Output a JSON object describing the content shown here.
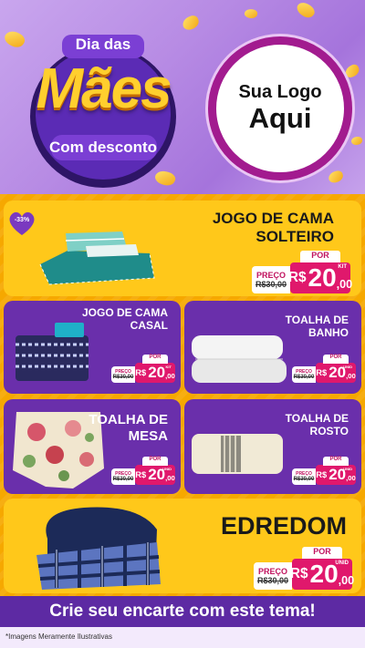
{
  "header": {
    "badge_line1": "Dia das",
    "badge_line2": "Mães",
    "badge_line3": "Com desconto",
    "logo_line1": "Sua Logo",
    "logo_line2": "Aqui"
  },
  "discount_badge": "-33%",
  "products": [
    {
      "id": "solteiro",
      "title": "JOGO DE CAMA SOLTEIRO",
      "price_label": "PREÇO",
      "por_label": "POR",
      "old_price": "R$30,00",
      "currency": "R$",
      "price": "20,00",
      "price_int": "20",
      "price_dec": ",00",
      "unit": "KIT",
      "icon": "bed-sheet-set-image"
    },
    {
      "id": "casal",
      "title": "JOGO DE CAMA CASAL",
      "price_label": "PREÇO",
      "por_label": "POR",
      "old_price": "R$30,00",
      "currency": "R$",
      "price_int": "20",
      "price_dec": ",00",
      "unit": "KIT",
      "icon": "bed-sheet-set-image"
    },
    {
      "id": "banho",
      "title": "TOALHA DE BANHO",
      "price_label": "PREÇO",
      "por_label": "POR",
      "old_price": "R$30,00",
      "currency": "R$",
      "price_int": "20",
      "price_dec": ",00",
      "unit": "UNID",
      "icon": "towel-image"
    },
    {
      "id": "mesa",
      "title": "TOALHA DE MESA",
      "price_label": "PREÇO",
      "por_label": "POR",
      "old_price": "R$30,00",
      "currency": "R$",
      "price_int": "20",
      "price_dec": ",00",
      "unit": "UNID",
      "icon": "tablecloth-image"
    },
    {
      "id": "rosto",
      "title": "TOALHA DE ROSTO",
      "price_label": "PREÇO",
      "por_label": "POR",
      "old_price": "R$30,00",
      "currency": "R$",
      "price_int": "20",
      "price_dec": ",00",
      "unit": "UNID",
      "icon": "face-towel-image"
    },
    {
      "id": "edredom",
      "title": "EDREDOM",
      "price_label": "PREÇO",
      "por_label": "POR",
      "old_price": "R$30,00",
      "currency": "R$",
      "price_int": "20",
      "price_dec": ",00",
      "unit": "UNID",
      "icon": "comforter-image"
    }
  ],
  "footer": {
    "cta": "Crie seu encarte com este tema!",
    "disclaimer": "*Imagens Meramente Ilustrativas"
  },
  "colors": {
    "purple": "#6a2fab",
    "yellow": "#ffc81a",
    "orange": "#f6a800",
    "magenta": "#e0186c",
    "logo_ring": "#a21b8f"
  }
}
